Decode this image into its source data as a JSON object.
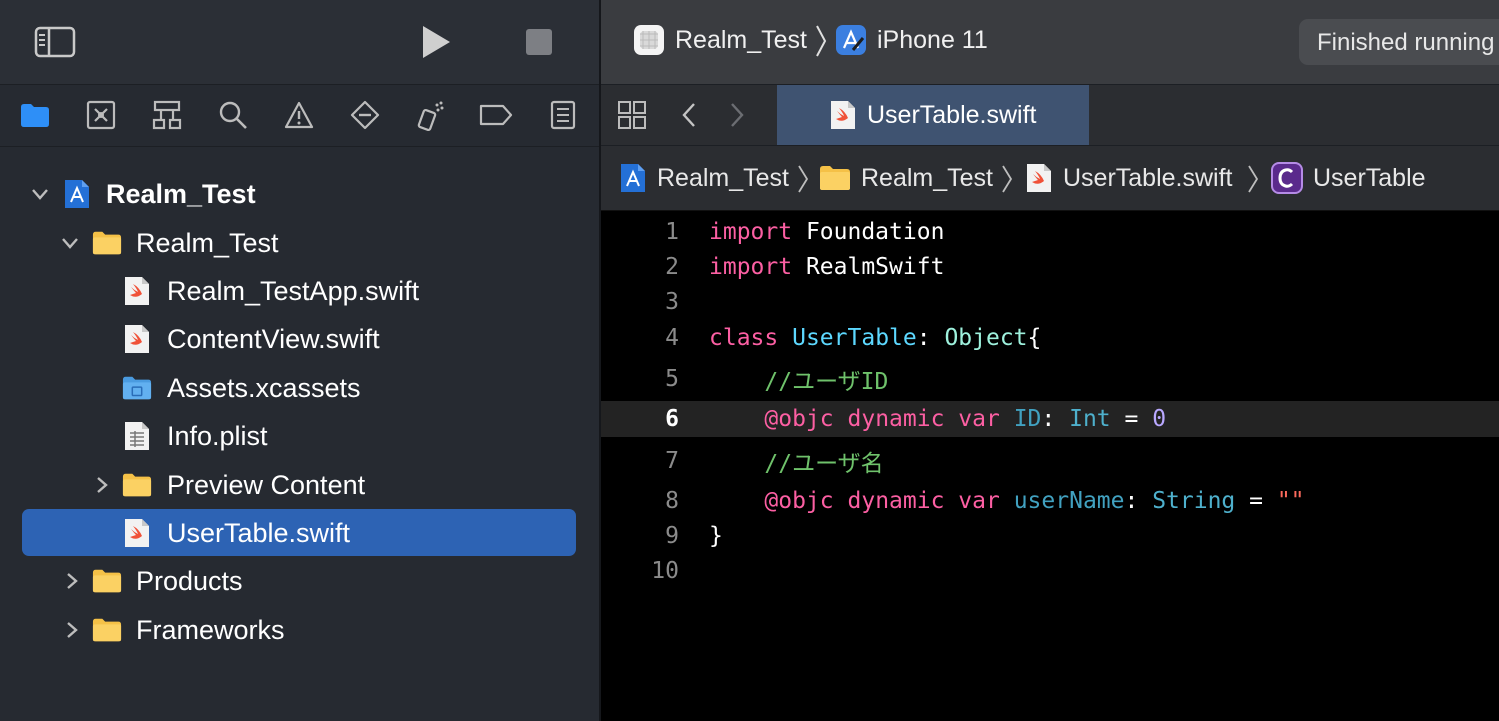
{
  "toolbar": {
    "scheme": "Realm_Test",
    "device": "iPhone 11",
    "status": "Finished running"
  },
  "tab": {
    "label": "UserTable.swift"
  },
  "navigator": {
    "items": [
      {
        "label": "Realm_Test",
        "kind": "project",
        "expanded": true
      },
      {
        "label": "Realm_Test",
        "kind": "folder",
        "expanded": true
      },
      {
        "label": "Realm_TestApp.swift",
        "kind": "swift"
      },
      {
        "label": "ContentView.swift",
        "kind": "swift"
      },
      {
        "label": "Assets.xcassets",
        "kind": "assets"
      },
      {
        "label": "Info.plist",
        "kind": "plist"
      },
      {
        "label": "Preview Content",
        "kind": "folder",
        "expanded": false
      },
      {
        "label": "UserTable.swift",
        "kind": "swift",
        "selected": true
      },
      {
        "label": "Products",
        "kind": "folder",
        "expanded": false
      },
      {
        "label": "Frameworks",
        "kind": "folder",
        "expanded": false
      }
    ]
  },
  "breadcrumb": {
    "items": [
      "Realm_Test",
      "Realm_Test",
      "UserTable.swift",
      "UserTable"
    ]
  },
  "code": {
    "current_line": 6,
    "lines": [
      {
        "n": "1",
        "tokens": [
          [
            "kw",
            "import"
          ],
          [
            "plain",
            " Foundation"
          ]
        ]
      },
      {
        "n": "2",
        "tokens": [
          [
            "kw",
            "import"
          ],
          [
            "plain",
            " RealmSwift"
          ]
        ]
      },
      {
        "n": "3",
        "tokens": []
      },
      {
        "n": "4",
        "tokens": [
          [
            "kw",
            "class"
          ],
          [
            "plain",
            " "
          ],
          [
            "type-decl",
            "UserTable"
          ],
          [
            "plain",
            ": "
          ],
          [
            "type-other",
            "Object"
          ],
          [
            "plain",
            "{"
          ]
        ]
      },
      {
        "n": "5",
        "tokens": [
          [
            "plain",
            "    "
          ],
          [
            "comment",
            "//ユーザID"
          ]
        ]
      },
      {
        "n": "6",
        "tokens": [
          [
            "plain",
            "    "
          ],
          [
            "kw",
            "@objc"
          ],
          [
            "plain",
            " "
          ],
          [
            "kw",
            "dynamic"
          ],
          [
            "plain",
            " "
          ],
          [
            "kw",
            "var"
          ],
          [
            "plain",
            " "
          ],
          [
            "prop",
            "ID"
          ],
          [
            "plain",
            ": "
          ],
          [
            "typeref",
            "Int"
          ],
          [
            "plain",
            " = "
          ],
          [
            "num",
            "0"
          ]
        ]
      },
      {
        "n": "7",
        "tokens": [
          [
            "plain",
            "    "
          ],
          [
            "comment",
            "//ユーザ名"
          ]
        ]
      },
      {
        "n": "8",
        "tokens": [
          [
            "plain",
            "    "
          ],
          [
            "kw",
            "@objc"
          ],
          [
            "plain",
            " "
          ],
          [
            "kw",
            "dynamic"
          ],
          [
            "plain",
            " "
          ],
          [
            "kw",
            "var"
          ],
          [
            "plain",
            " "
          ],
          [
            "prop",
            "userName"
          ],
          [
            "plain",
            ": "
          ],
          [
            "typeref",
            "String"
          ],
          [
            "plain",
            " = "
          ],
          [
            "str",
            "\"\""
          ]
        ]
      },
      {
        "n": "9",
        "tokens": [
          [
            "plain",
            "}"
          ]
        ]
      },
      {
        "n": "10",
        "tokens": []
      }
    ]
  },
  "colors": {
    "selection": "#2d63b4",
    "keyword": "#fc5fa3",
    "comment": "#6fc26b",
    "type": "#5dd8ff",
    "number": "#b9a8ff",
    "string": "#fc6a5d"
  }
}
